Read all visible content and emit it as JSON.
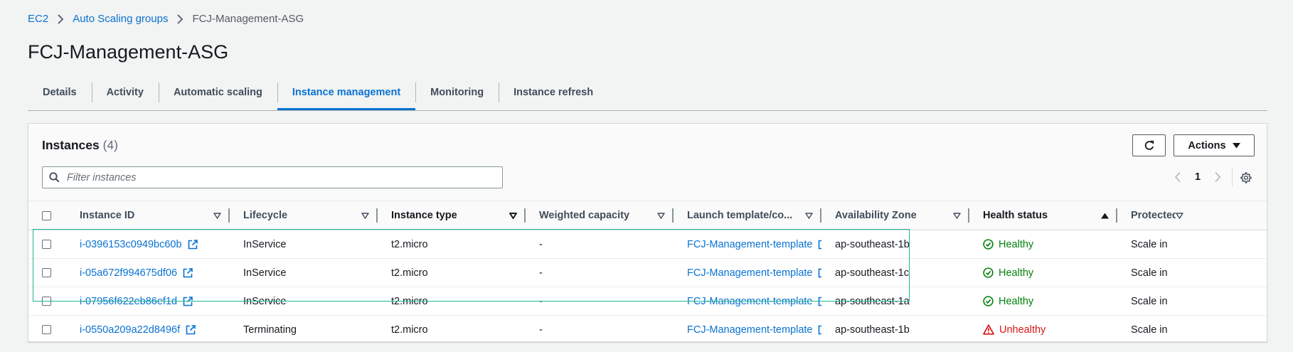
{
  "breadcrumb": {
    "ec2": "EC2",
    "asg": "Auto Scaling groups",
    "current": "FCJ-Management-ASG"
  },
  "page_title": "FCJ-Management-ASG",
  "tabs": [
    {
      "label": "Details"
    },
    {
      "label": "Activity"
    },
    {
      "label": "Automatic scaling"
    },
    {
      "label": "Instance management",
      "active": true
    },
    {
      "label": "Monitoring"
    },
    {
      "label": "Instance refresh"
    }
  ],
  "instances_panel": {
    "title": "Instances",
    "count": "(4)",
    "actions_label": "Actions",
    "filter_placeholder": "Filter instances",
    "page_number": "1"
  },
  "columns": [
    {
      "label": "Instance ID",
      "sort": "sortable"
    },
    {
      "label": "Lifecycle",
      "sort": "sortable"
    },
    {
      "label": "Instance type",
      "sort": "sortable-bold"
    },
    {
      "label": "Weighted capacity",
      "sort": "sortable"
    },
    {
      "label": "Launch template/co...",
      "sort": "sortable"
    },
    {
      "label": "Availability Zone",
      "sort": "sortable"
    },
    {
      "label": "Health status",
      "sort": "ascending"
    },
    {
      "label": "Protected from",
      "sort": "sortable"
    }
  ],
  "rows": [
    {
      "instance_id": "i-0396153c0949bc60b",
      "lifecycle": "InService",
      "type": "t2.micro",
      "weighted_capacity": "-",
      "launch_template": "FCJ-Management-template",
      "az": "ap-southeast-1b",
      "health": "Healthy",
      "health_state": "ok",
      "protected": "Scale in"
    },
    {
      "instance_id": "i-05a672f994675df06",
      "lifecycle": "InService",
      "type": "t2.micro",
      "weighted_capacity": "-",
      "launch_template": "FCJ-Management-template",
      "az": "ap-southeast-1c",
      "health": "Healthy",
      "health_state": "ok",
      "protected": "Scale in"
    },
    {
      "instance_id": "i-07956f622eb86ef1d",
      "lifecycle": "InService",
      "type": "t2.micro",
      "weighted_capacity": "-",
      "launch_template": "FCJ-Management-template",
      "az": "ap-southeast-1a",
      "health": "Healthy",
      "health_state": "ok",
      "protected": "Scale in"
    },
    {
      "instance_id": "i-0550a209a22d8496f",
      "lifecycle": "Terminating",
      "type": "t2.micro",
      "weighted_capacity": "-",
      "launch_template": "FCJ-Management-template",
      "az": "ap-southeast-1b",
      "health": "Unhealthy",
      "health_state": "bad",
      "protected": "Scale in"
    }
  ],
  "colors": {
    "link": "#0972d3",
    "healthy": "#037f0c",
    "unhealthy": "#d91515",
    "highlight": "#20b596"
  },
  "icons": {
    "breadcrumb_separator": "chevron-right-icon",
    "refresh": "refresh-icon",
    "actions_caret": "caret-down-icon",
    "search": "search-icon",
    "pager_prev": "chevron-left-icon",
    "pager_next": "chevron-right-icon",
    "preferences": "gear-icon",
    "external_link": "external-link-icon",
    "healthy": "status-check-icon",
    "unhealthy": "warning-icon"
  }
}
